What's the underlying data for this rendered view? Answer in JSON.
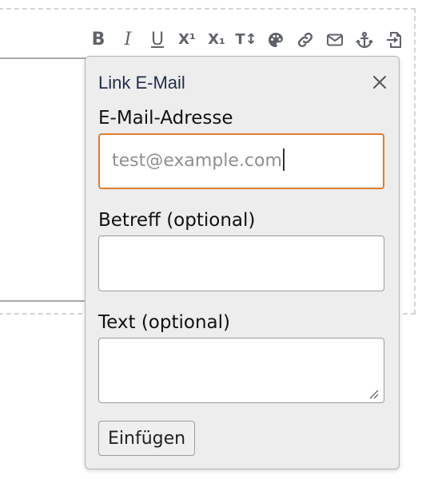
{
  "toolbar": {
    "buttons": [
      {
        "name": "bold-icon",
        "glyph": "B"
      },
      {
        "name": "italic-icon",
        "glyph": "I"
      },
      {
        "name": "underline-icon",
        "glyph": "U"
      },
      {
        "name": "superscript-icon",
        "glyph": "X¹"
      },
      {
        "name": "subscript-icon",
        "glyph": "X₁"
      },
      {
        "name": "font-size-icon",
        "glyph": "T↕"
      },
      {
        "name": "palette-icon"
      },
      {
        "name": "link-icon"
      },
      {
        "name": "email-icon"
      },
      {
        "name": "anchor-icon"
      },
      {
        "name": "insert-icon"
      }
    ]
  },
  "dialog": {
    "title": "Link E-Mail",
    "email_label": "E-Mail-Adresse",
    "email_placeholder": "test@example.com",
    "subject_label": "Betreff (optional)",
    "text_label": "Text (optional)",
    "submit_label": "Einfügen"
  },
  "colors": {
    "focus_border": "#e07c2f",
    "title": "#1f2d4a",
    "icon": "#5f6368"
  }
}
